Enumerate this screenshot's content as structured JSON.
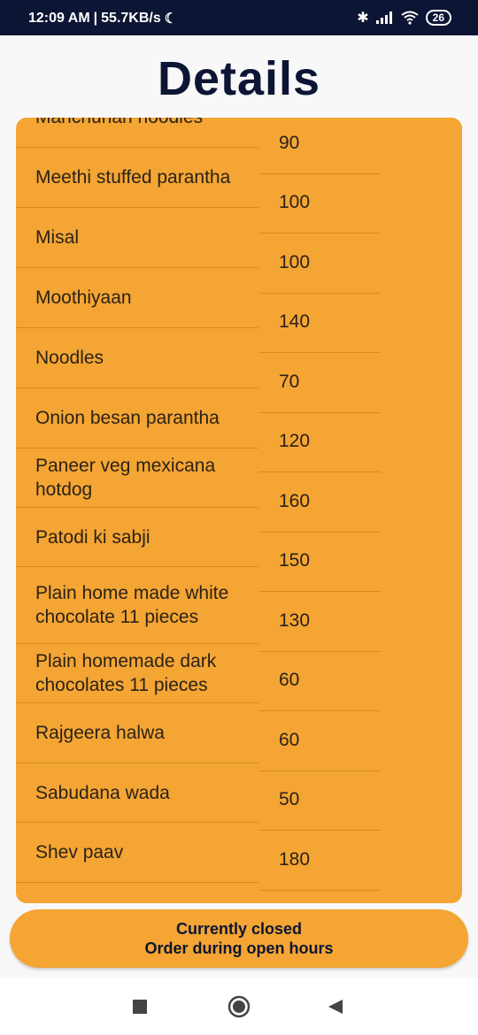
{
  "status": {
    "time": "12:09 AM",
    "network": "55.7KB/s",
    "battery": "26"
  },
  "page_title": "Details",
  "items": [
    {
      "name": "Manchurian noodles",
      "h": 68
    },
    {
      "name": "Meethi stuffed parantha",
      "h": 68
    },
    {
      "name": "Misal",
      "h": 68
    },
    {
      "name": "Moothiyaan",
      "h": 68
    },
    {
      "name": "Noodles",
      "h": 68
    },
    {
      "name": "Onion besan parantha",
      "h": 68
    },
    {
      "name": "Paneer veg mexicana hotdog",
      "h": 67
    },
    {
      "name": "Patodi ki sabji",
      "h": 67
    },
    {
      "name": "Plain home made white chocolate 11 pieces",
      "h": 87
    },
    {
      "name": "Plain homemade dark chocolates 11 pieces",
      "h": 67
    },
    {
      "name": "Rajgeera halwa",
      "h": 68
    },
    {
      "name": "Sabudana wada",
      "h": 67
    },
    {
      "name": "Shev paav",
      "h": 68
    }
  ],
  "prices": [
    "90",
    "100",
    "100",
    "140",
    "70",
    "120",
    "160",
    "150",
    "130",
    "60",
    "60",
    "50",
    "180"
  ],
  "closed_button": {
    "line1": "Currently closed",
    "line2": "Order during open hours"
  }
}
